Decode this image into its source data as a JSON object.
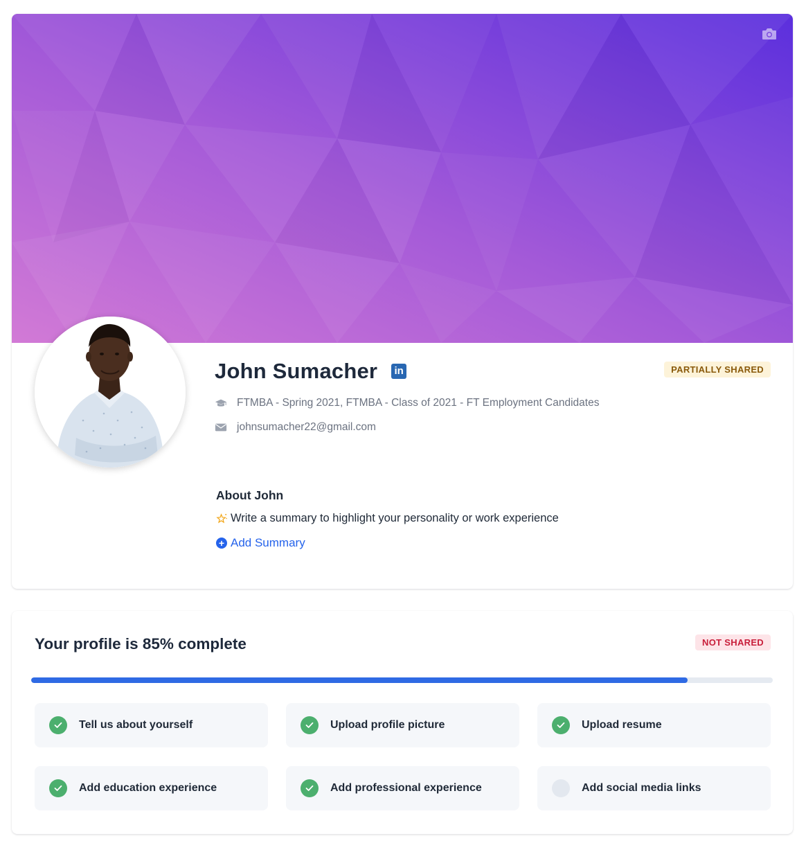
{
  "profile": {
    "name": "John Sumacher",
    "linkedin_icon": "linkedin-icon",
    "linkedin_text": "in",
    "share_status": "PARTIALLY SHARED",
    "program": "FTMBA - Spring 2021, FTMBA - Class of 2021 - FT Employment Candidates",
    "email": "johnsumacher22@gmail.com",
    "cover_icon": "camera-icon",
    "about": {
      "title": "About John",
      "hint": "Write a summary to highlight your personality or work experience",
      "add_label": "Add Summary"
    }
  },
  "completion": {
    "title": "Your profile is 85% complete",
    "percent": 85,
    "progress_fraction": 0.885,
    "share_status": "NOT SHARED",
    "tasks": [
      {
        "label": "Tell us about yourself",
        "done": true
      },
      {
        "label": "Upload profile picture",
        "done": true
      },
      {
        "label": "Upload resume",
        "done": true
      },
      {
        "label": "Add education experience",
        "done": true
      },
      {
        "label": "Add professional experience",
        "done": true
      },
      {
        "label": "Add social media links",
        "done": false
      }
    ]
  },
  "colors": {
    "accent": "#2563eb",
    "progress": "#2f6ae4",
    "done": "#4caf6e",
    "partial_badge_bg": "#fdf3d9",
    "partial_badge_text": "#8a5a0b",
    "not_shared_bg": "#fde4e8",
    "not_shared_text": "#c81e3a",
    "cover_start": "#c26fd8",
    "cover_end": "#5a2fd9"
  }
}
